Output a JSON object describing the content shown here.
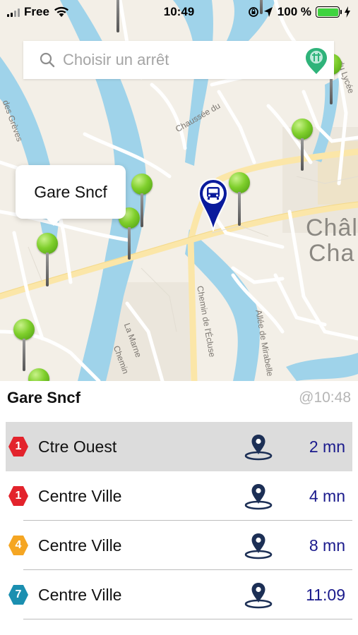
{
  "status_bar": {
    "carrier": "Free",
    "time": "10:49",
    "battery": "100 %",
    "battery_level": 1.0
  },
  "search": {
    "placeholder": "Choisir un arrêt",
    "icon": "search-icon"
  },
  "map": {
    "labels": {
      "greves": "des Grèves",
      "chaussee": "Chaussée du",
      "marne": "La Marne",
      "ecluse": "Chemin de l'Écluse",
      "mirabelle": "Allée de Mirabelle",
      "chemin": "Chemin",
      "lycee": "du Lycée",
      "chal": "Châl",
      "cha": "Cha"
    },
    "callout": "Gare Sncf",
    "colors": {
      "water": "#9fd3ea",
      "road": "#ffffff",
      "major_road": "#fbe6a8",
      "pin_green": "#7fcf2c",
      "bus_marker": "#0a1b9c"
    }
  },
  "stop": {
    "name": "Gare Sncf",
    "updated": "@10:48"
  },
  "departures": [
    {
      "line": "1",
      "line_color": "#e3232c",
      "destination": "Ctre Ouest",
      "eta": "2 mn"
    },
    {
      "line": "1",
      "line_color": "#e3232c",
      "destination": "Centre Ville",
      "eta": "4 mn"
    },
    {
      "line": "4",
      "line_color": "#f5a623",
      "destination": "Centre Ville",
      "eta": "8 mn"
    },
    {
      "line": "7",
      "line_color": "#1b8fb0",
      "destination": "Centre Ville",
      "eta": "11:09"
    }
  ]
}
